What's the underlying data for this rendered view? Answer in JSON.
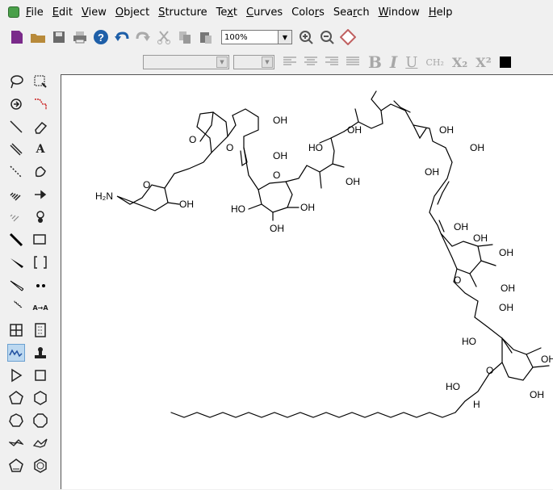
{
  "menu": {
    "items": [
      {
        "label": "File",
        "u": "F",
        "rest": "ile"
      },
      {
        "label": "Edit",
        "u": "E",
        "rest": "dit"
      },
      {
        "label": "View",
        "u": "V",
        "rest": "iew"
      },
      {
        "label": "Object",
        "u": "O",
        "rest": "bject"
      },
      {
        "label": "Structure",
        "u": "S",
        "rest": "tructure"
      },
      {
        "label": "Text",
        "u": "Te",
        "rest": "xt",
        "uAt": 2
      },
      {
        "label": "Curves",
        "u": "C",
        "rest": "urves"
      },
      {
        "label": "Colors",
        "u": "Colo",
        "rest": "rs"
      },
      {
        "label": "Search",
        "u": "Sea",
        "rest": "rch"
      },
      {
        "label": "Window",
        "u": "W",
        "rest": "indow"
      },
      {
        "label": "Help",
        "u": "H",
        "rest": "elp"
      }
    ]
  },
  "toolbar": {
    "zoom_value": "100%"
  },
  "format": {
    "bold": "B",
    "italic": "I",
    "underline": "U",
    "ch2": "CH₂",
    "subscript": "X₂",
    "superscript": "X²"
  },
  "molecule": {
    "labels": {
      "oh": "OH",
      "ho": "HO",
      "o": "O",
      "h": "H",
      "h2n": "H₂N"
    }
  }
}
